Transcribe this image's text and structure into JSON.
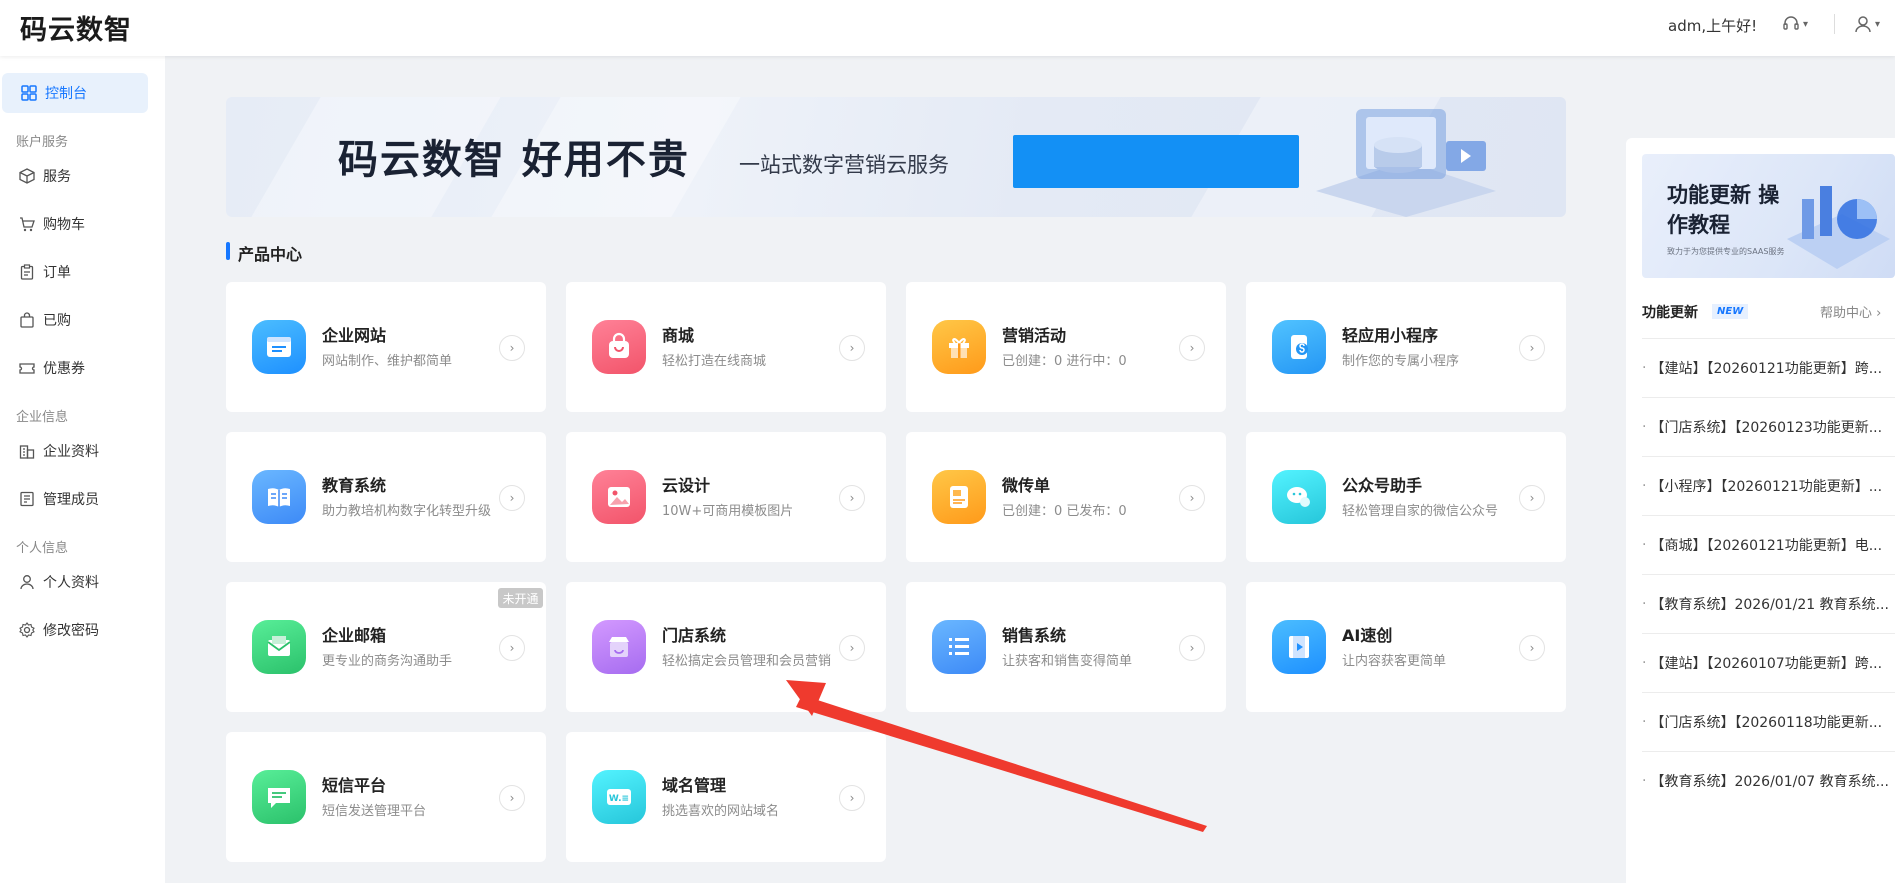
{
  "header": {
    "brand": "码云数智",
    "greeting": "adm,上午好!"
  },
  "sidebar": {
    "console": "控制台",
    "groups": {
      "account": "账户服务",
      "company": "企业信息",
      "personal": "个人信息"
    },
    "items": {
      "service": "服务",
      "cart": "购物车",
      "orders": "订单",
      "purchased": "已购",
      "coupons": "优惠券",
      "company_profile": "企业资料",
      "members": "管理成员",
      "personal_profile": "个人资料",
      "change_password": "修改密码"
    }
  },
  "banner": {
    "title": "码云数智  好用不贵",
    "subtitle": "一站式数字营销云服务"
  },
  "products": {
    "section_title": "产品中心",
    "cards": [
      {
        "title": "企业网站",
        "desc": "网站制作、维护都简单",
        "icon": "website-icon",
        "color": "#1e90ff"
      },
      {
        "title": "商城",
        "desc": "轻松打造在线商城",
        "icon": "shopping-bag-icon",
        "color": "#f2546a"
      },
      {
        "title": "营销活动",
        "desc": "已创建：0     进行中：0",
        "icon": "gift-icon",
        "color": "#ff9a1a"
      },
      {
        "title": "轻应用小程序",
        "desc": "制作您的专属小程序",
        "icon": "mini-program-icon",
        "color": "#2496f5"
      },
      {
        "title": "教育系统",
        "desc": "助力教培机构数字化转型升级",
        "icon": "book-icon",
        "color": "#3d8af7"
      },
      {
        "title": "云设计",
        "desc": "10W+可商用模板图片",
        "icon": "image-icon",
        "color": "#f2546a"
      },
      {
        "title": "微传单",
        "desc": "已创建：0     已发布：0",
        "icon": "flyer-icon",
        "color": "#ff9a1a"
      },
      {
        "title": "公众号助手",
        "desc": "轻松管理自家的微信公众号",
        "icon": "wechat-icon",
        "color": "#26c6da"
      },
      {
        "title": "企业邮箱",
        "desc": "更专业的商务沟通助手",
        "icon": "mail-icon",
        "color": "#2bc16b",
        "badge": "未开通"
      },
      {
        "title": "门店系统",
        "desc": "轻松搞定会员管理和会员营销",
        "icon": "store-icon",
        "color": "#a66cf0"
      },
      {
        "title": "销售系统",
        "desc": "让获客和销售变得简单",
        "icon": "list-icon",
        "color": "#3d8af7"
      },
      {
        "title": "AI速创",
        "desc": "让内容获客更简单",
        "icon": "video-icon",
        "color": "#1e90ff"
      },
      {
        "title": "短信平台",
        "desc": "短信发送管理平台",
        "icon": "sms-icon",
        "color": "#2bc16b"
      },
      {
        "title": "域名管理",
        "desc": "挑选喜欢的网站域名",
        "icon": "domain-icon",
        "color": "#26c6da"
      }
    ]
  },
  "right_panel": {
    "tutorial_title": "功能更新 操作教程",
    "tutorial_sub": "致力于为您提供专业的SAAS服务",
    "updates_title": "功能更新",
    "new_badge": "NEW",
    "help_link": "帮助中心",
    "updates": [
      "【建站】【20260121功能更新】跨...",
      "【门店系统】【20260123功能更新...",
      "【小程序】【20260121功能更新】...",
      "【商城】【20260121功能更新】电...",
      "【教育系统】2026/01/21 教育系统...",
      "【建站】【20260107功能更新】跨...",
      "【门店系统】【20260118功能更新...",
      "【教育系统】2026/01/07 教育系统..."
    ]
  }
}
